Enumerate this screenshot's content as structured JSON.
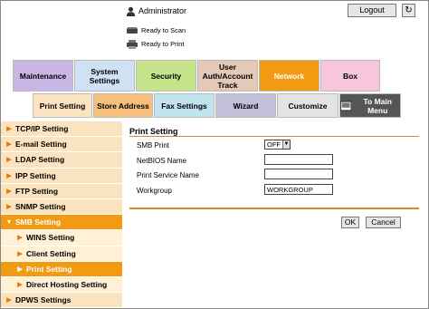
{
  "header": {
    "user_name": "Administrator",
    "logout_label": "Logout",
    "refresh_icon": "refresh-icon",
    "status": [
      {
        "icon": "scanner-icon",
        "text": "Ready to Scan"
      },
      {
        "icon": "printer-icon",
        "text": "Ready to Print"
      }
    ]
  },
  "main_tabs": [
    {
      "label": "Maintenance"
    },
    {
      "label": "System Settings"
    },
    {
      "label": "Security"
    },
    {
      "label": "User Auth/Account Track"
    },
    {
      "label": "Network"
    },
    {
      "label": "Box"
    }
  ],
  "sub_tabs": [
    {
      "label": "Print Setting"
    },
    {
      "label": "Store Address"
    },
    {
      "label": "Fax Settings"
    },
    {
      "label": "Wizard"
    },
    {
      "label": "Customize"
    },
    {
      "label": "To Main Menu"
    }
  ],
  "sidebar": {
    "items": [
      {
        "label": "TCP/IP Setting"
      },
      {
        "label": "E-mail Setting"
      },
      {
        "label": "LDAP Setting"
      },
      {
        "label": "IPP Setting"
      },
      {
        "label": "FTP Setting"
      },
      {
        "label": "SNMP Setting"
      },
      {
        "label": "SMB Setting"
      },
      {
        "label": "WINS Setting"
      },
      {
        "label": "Client Setting"
      },
      {
        "label": "Print Setting"
      },
      {
        "label": "Direct Hosting Setting"
      },
      {
        "label": "DPWS Settings"
      }
    ]
  },
  "content": {
    "title": "Print Setting",
    "fields": {
      "smb_print": {
        "label": "SMB Print",
        "value": "OFF"
      },
      "netbios_name": {
        "label": "NetBIOS Name",
        "value": ""
      },
      "print_service_name": {
        "label": "Print Service Name",
        "value": ""
      },
      "workgroup": {
        "label": "Workgroup",
        "value": "WORKGROUP"
      }
    },
    "ok_label": "OK",
    "cancel_label": "Cancel"
  },
  "colors": {
    "accent_orange": "#f29a12",
    "sidebar_light": "#fbe3bf",
    "tab_maintenance": "#c9b6e4",
    "tab_system": "#cfe1f2",
    "tab_security": "#c6e48a",
    "tab_user": "#e3c9b6",
    "tab_network": "#f29a12",
    "tab_box": "#f7c6dc"
  }
}
